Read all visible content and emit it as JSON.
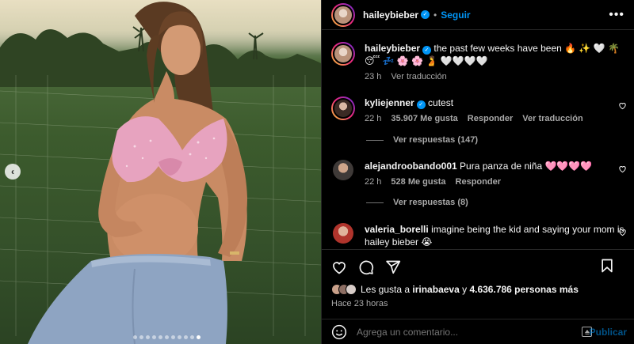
{
  "header": {
    "username": "haileybieber",
    "follow_label": "Seguir",
    "more_label": "•••"
  },
  "caption": {
    "username": "haileybieber",
    "text": "the past few weeks have been 🔥 ✨ 🤍 🌴 😴 💤 🌸 🌸 🫄 🤍🤍🤍🤍",
    "time": "23 h",
    "translate": "Ver traducción"
  },
  "comments": [
    {
      "username": "kyliejenner",
      "verified": true,
      "text": "cutest",
      "time": "22 h",
      "likes": "35.907 Me gusta",
      "reply": "Responder",
      "translate": "Ver traducción",
      "view_replies": "Ver respuestas (147)"
    },
    {
      "username": "alejandroobando001",
      "verified": false,
      "text": "Pura panza de niña 🩷🩷🩷🩷",
      "time": "22 h",
      "likes": "528 Me gusta",
      "reply": "Responder",
      "view_replies": "Ver respuestas (8)"
    },
    {
      "username": "valeria_borelli",
      "verified": false,
      "text": "imagine being the kid and saying your mom is hailey bieber 😭"
    }
  ],
  "likes": {
    "prefix": "Les gusta a",
    "user": "irinabaeva",
    "middle": "y",
    "count": "4.636.786 personas más"
  },
  "time_ago": "Hace 23 horas",
  "comment_box": {
    "placeholder": "Agrega un comentario...",
    "post_label": "Publicar"
  },
  "carousel": {
    "total": 11,
    "active_index": 10
  },
  "colors": {
    "accent": "#0095f6",
    "muted": "#a8a8a8",
    "background": "#000000"
  }
}
